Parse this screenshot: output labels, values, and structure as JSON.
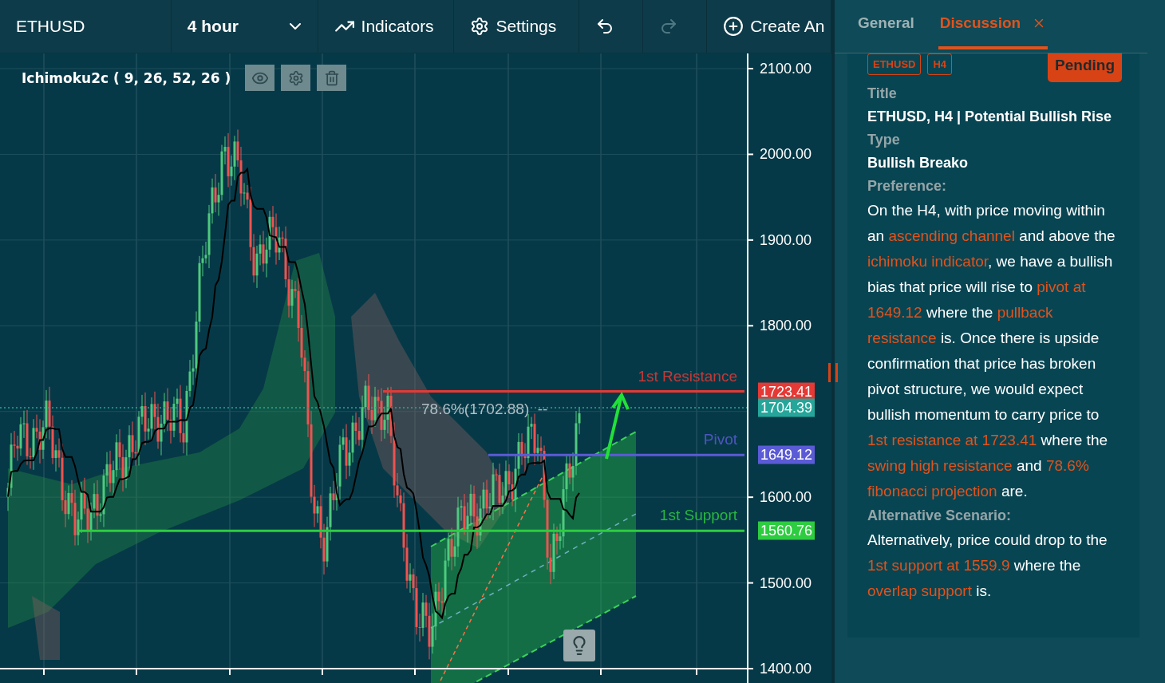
{
  "toolbar": {
    "symbol": "ETHUSD",
    "interval": "4 hour",
    "buttons": [
      {
        "kind": "indicators",
        "label": "Indicators",
        "disabled": false
      },
      {
        "kind": "settings",
        "label": "Settings",
        "disabled": false
      },
      {
        "kind": "undo",
        "disabled": false
      },
      {
        "kind": "redo",
        "disabled": true
      },
      {
        "kind": "create",
        "label": "Create An",
        "disabled": false
      }
    ]
  },
  "chart": {
    "indicator": "Ichimoku2c ( 9, 26, 52, 26 )",
    "price_axis": [
      "2100.00",
      "2000.00",
      "1900.00",
      "1800.00",
      "1600.00",
      "1500.00",
      "1400.00"
    ],
    "fib_label": "78.6%(1702.88)  --",
    "levels": [
      {
        "kind": "resistance",
        "label": "1st Resistance",
        "price": "1723.41",
        "color": "#e53935"
      },
      {
        "kind": "current",
        "price": "1704.39",
        "color": "#26a69a"
      },
      {
        "kind": "pivot",
        "label": "Pivot",
        "price": "1649.12",
        "color": "#5b5bd6"
      },
      {
        "kind": "support",
        "label": "1st Support",
        "price": "1560.76",
        "color": "#2ecc40"
      }
    ]
  },
  "panel": {
    "tabs": [
      {
        "label": "General",
        "selected": false
      },
      {
        "label": "Discussion",
        "selected": true
      }
    ],
    "tags": [
      "ETHUSD",
      "H4"
    ],
    "status": "Pending",
    "fields": [
      {
        "label": "Title",
        "value": "ETHUSD, H4 | Potential Bullish Rise"
      },
      {
        "label": "Type",
        "value": "Bullish Breako"
      }
    ],
    "sections": [
      {
        "label": "Preference:",
        "segments": [
          {
            "text": "On the H4, with price moving within an ",
            "highlight": false
          },
          {
            "text": "ascending channel",
            "highlight": true
          },
          {
            "text": " and above the ",
            "highlight": false
          },
          {
            "text": "ichimoku indicator",
            "highlight": true
          },
          {
            "text": ", we have a bullish bias that price will rise to ",
            "highlight": false
          },
          {
            "text": "pivot at 1649.12",
            "highlight": true
          },
          {
            "text": " where the ",
            "highlight": false
          },
          {
            "text": "pullback resistance",
            "highlight": true
          },
          {
            "text": " is. Once there is upside confirmation that price has broken pivot structure, we would expect bullish momentum to carry price to ",
            "highlight": false
          },
          {
            "text": "1st resistance at 1723.41",
            "highlight": true
          },
          {
            "text": " where the ",
            "highlight": false
          },
          {
            "text": "swing high resistance",
            "highlight": true
          },
          {
            "text": " and ",
            "highlight": false
          },
          {
            "text": "78.6% fibonacci projection",
            "highlight": true
          },
          {
            "text": " are.",
            "highlight": false
          }
        ]
      },
      {
        "label": "Alternative Scenario:",
        "segments": [
          {
            "text": "Alternatively, price could drop to the ",
            "highlight": false
          },
          {
            "text": "1st support at 1559.9",
            "highlight": true
          },
          {
            "text": " where the ",
            "highlight": false
          },
          {
            "text": "overlap support",
            "highlight": true
          },
          {
            "text": " is.",
            "highlight": false
          }
        ]
      }
    ]
  }
}
